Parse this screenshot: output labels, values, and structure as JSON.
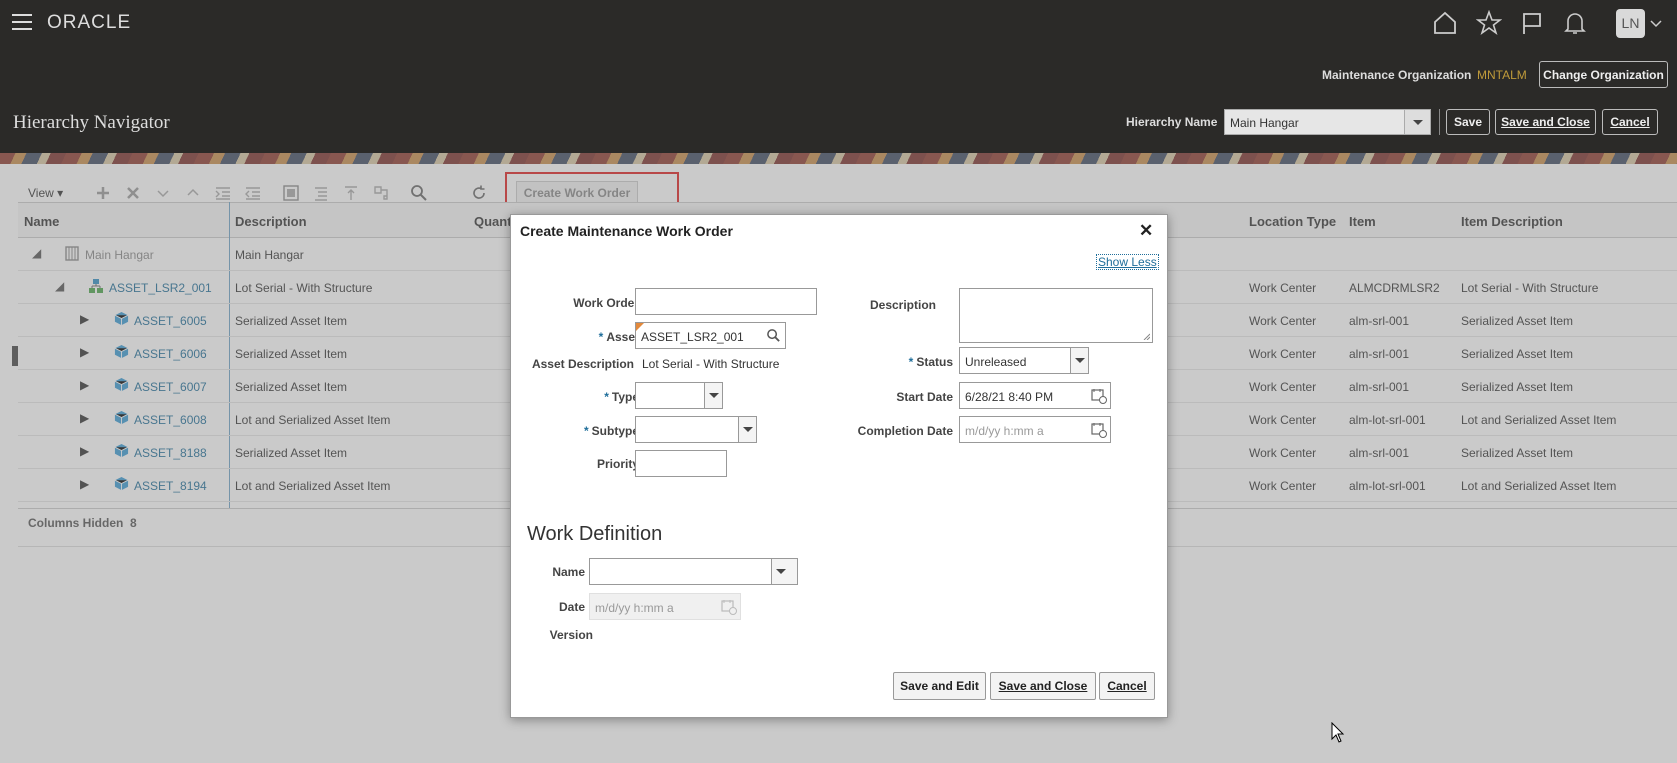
{
  "header": {
    "brand": "ORACLE",
    "avatar_initials": "LN",
    "org_label": "Maintenance Organization",
    "org_value": "MNTALM",
    "change_org_label": "Change Organization",
    "page_title": "Hierarchy Navigator",
    "hierarchy_name_label": "Hierarchy Name",
    "hierarchy_name_value": "Main Hangar",
    "save_label": "Save",
    "save_close_label": "Save and Close",
    "cancel_label": "Cancel",
    "icons": [
      "home-icon",
      "favorites-star-icon",
      "flag-icon",
      "notifications-bell-icon"
    ]
  },
  "toolbar": {
    "view_label": "View",
    "create_work_order_label": "Create Work Order"
  },
  "grid": {
    "columns": {
      "name": "Name",
      "description": "Description",
      "quantity": "Quant",
      "location_type": "Location Type",
      "item": "Item",
      "item_description": "Item Description"
    },
    "rows": [
      {
        "name": "Main Hangar",
        "description": "Main Hangar",
        "location_type": "",
        "item": "",
        "item_description": ""
      },
      {
        "name": "ASSET_LSR2_001",
        "description": "Lot Serial - With Structure",
        "location_type": "Work Center",
        "item": "ALMCDRMLSR2",
        "item_description": "Lot Serial - With Structure"
      },
      {
        "name": "ASSET_6005",
        "description": "Serialized Asset Item",
        "location_type": "Work Center",
        "item": "alm-srl-001",
        "item_description": "Serialized Asset Item"
      },
      {
        "name": "ASSET_6006",
        "description": "Serialized Asset Item",
        "location_type": "Work Center",
        "item": "alm-srl-001",
        "item_description": "Serialized Asset Item"
      },
      {
        "name": "ASSET_6007",
        "description": "Serialized Asset Item",
        "location_type": "Work Center",
        "item": "alm-srl-001",
        "item_description": "Serialized Asset Item"
      },
      {
        "name": "ASSET_6008",
        "description": "Lot and Serialized Asset Item",
        "location_type": "Work Center",
        "item": "alm-lot-srl-001",
        "item_description": "Lot and Serialized Asset Item"
      },
      {
        "name": "ASSET_8188",
        "description": "Serialized Asset Item",
        "location_type": "Work Center",
        "item": "alm-srl-001",
        "item_description": "Serialized Asset Item"
      },
      {
        "name": "ASSET_8194",
        "description": "Lot and Serialized Asset Item",
        "location_type": "Work Center",
        "item": "alm-lot-srl-001",
        "item_description": "Lot and Serialized Asset Item"
      }
    ],
    "columns_hidden_label": "Columns Hidden",
    "columns_hidden_count": "8"
  },
  "dialog": {
    "title": "Create Maintenance Work Order",
    "show_less": "Show Less",
    "work_order_label": "Work Order",
    "work_order_value": "",
    "asset_label": "Asset",
    "asset_value": "ASSET_LSR2_001",
    "asset_desc_label": "Asset Description",
    "asset_desc_value": "Lot Serial - With Structure",
    "type_label": "Type",
    "subtype_label": "Subtype",
    "priority_label": "Priority",
    "description_label": "Description",
    "status_label": "Status",
    "status_value": "Unreleased",
    "start_date_label": "Start Date",
    "start_date_value": "6/28/21 8:40 PM",
    "completion_date_label": "Completion Date",
    "completion_date_placeholder": "m/d/yy h:mm a",
    "work_definition_title": "Work Definition",
    "wd_name_label": "Name",
    "wd_date_label": "Date",
    "wd_date_placeholder": "m/d/yy h:mm a",
    "wd_version_label": "Version",
    "save_edit_label": "Save and Edit",
    "save_close_label": "Save and Close",
    "cancel_label": "Cancel"
  }
}
